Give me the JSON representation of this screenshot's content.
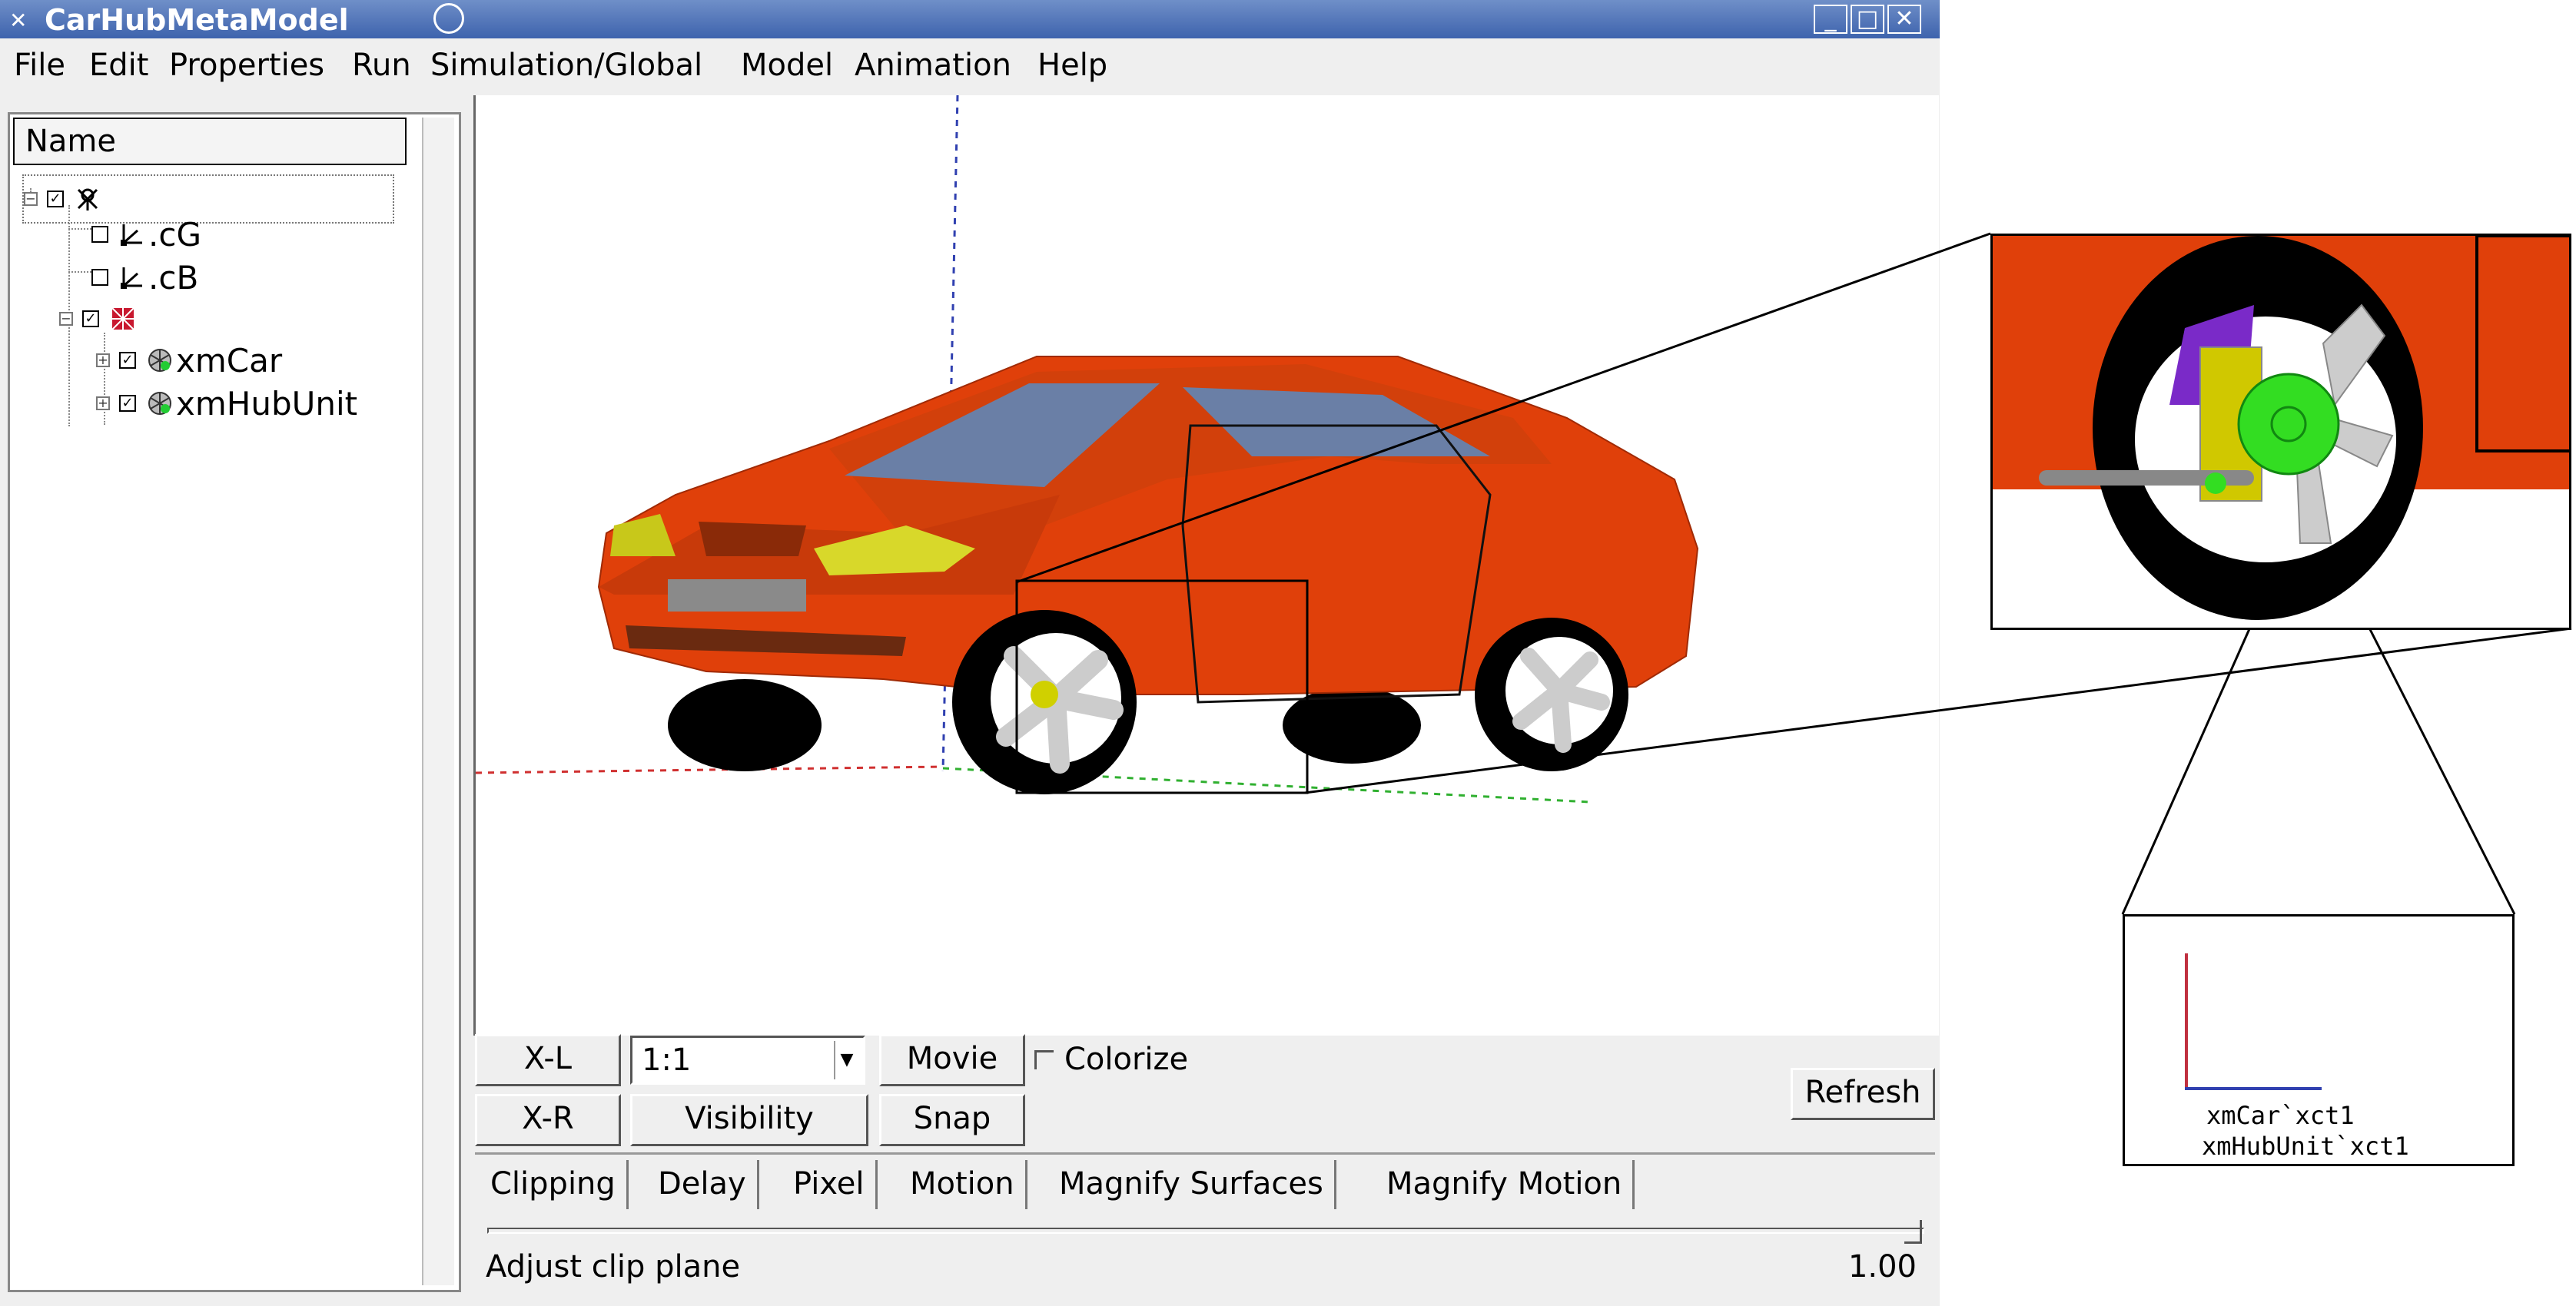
{
  "window": {
    "title": "CarHubMetaModel",
    "controls": [
      "_",
      "□",
      "✕"
    ]
  },
  "menu": [
    "File",
    "Edit",
    "Properties",
    "Run",
    "Simulation/Global",
    "Model",
    "Animation",
    "Help"
  ],
  "tree": {
    "header": "Name",
    "items": [
      {
        "label": "",
        "icon": "light-icon",
        "checked": true,
        "level": 0
      },
      {
        "label": ".cG",
        "icon": "axes-icon",
        "checked": false,
        "level": 1
      },
      {
        "label": ".cB",
        "icon": "axes-icon",
        "checked": false,
        "level": 1
      },
      {
        "label": "",
        "icon": "model-icon",
        "checked": true,
        "level": 1
      },
      {
        "label": "xmCar",
        "icon": "mesh-icon",
        "checked": true,
        "level": 2
      },
      {
        "label": "xmHubUnit",
        "icon": "mesh-icon",
        "checked": true,
        "level": 2
      }
    ]
  },
  "controls": {
    "xl": "X-L",
    "xr": "X-R",
    "scale": "1:1",
    "movie": "Movie",
    "visibility": "Visibility",
    "snap": "Snap",
    "colorize": "Colorize",
    "refresh": "Refresh"
  },
  "tabs": [
    "Clipping",
    "Delay",
    "Pixel",
    "Motion",
    "Magnify Surfaces",
    "Magnify Motion"
  ],
  "status": {
    "label": "Adjust clip plane",
    "value": "1.00"
  },
  "legend": {
    "line1": "xmCar`xct1",
    "line2": "xmHubUnit`xct1"
  },
  "colors": {
    "car_body": "#e0400a",
    "glass": "#6a7fa6",
    "tire": "#000000",
    "hub": "#33dd22"
  }
}
